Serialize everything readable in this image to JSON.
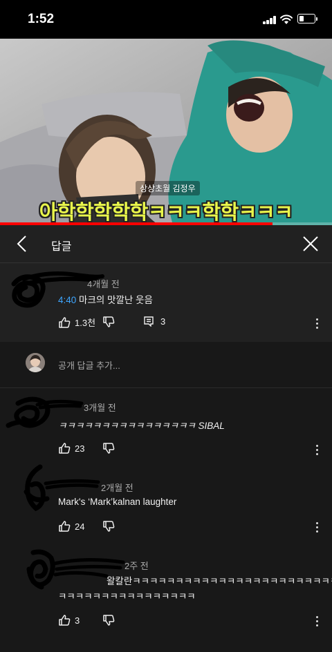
{
  "status_bar": {
    "time": "1:52"
  },
  "video": {
    "caption_name": "상상초월 김정우",
    "caption_main": "아학학학학학ㅋㅋㅋ학학ㅋㅋㅋ",
    "progress": 0.82
  },
  "header": {
    "title": "답글"
  },
  "parent_comment": {
    "age": "4개월 전",
    "timestamp": "4:40",
    "text": " 마크의 맛깔난 웃음",
    "likes": "1.3천",
    "replies": "3"
  },
  "add_reply": {
    "placeholder": "공개 답글 추가..."
  },
  "replies": [
    {
      "age": "3개월 전",
      "text": "ㅋㅋㅋㅋㅋㅋㅋㅋㅋㅋㅋㅋㅋㅋㅋㅋ SIBAL",
      "likes": "23"
    },
    {
      "age": "2개월 전",
      "text": "Mark's ‘Mark’kalnan laughter",
      "likes": "24"
    },
    {
      "age": "2주 전",
      "text_line1": "왈칼란ㅋㅋㅋㅋㅋㅋㅋㅋㅋㅋㅋㅋㅋㅋㅋㅋㅋㅋㅋㅋㅋㅋㅋㅋ",
      "text_line2": "ㅋㅋㅋㅋㅋㅋㅋㅋㅋㅋㅋㅋㅋㅋㅋㅋ",
      "likes": "3"
    }
  ],
  "colors": {
    "accent": "#3ea6ff",
    "progress": "#ff0000",
    "caption": "#e9f64b"
  }
}
